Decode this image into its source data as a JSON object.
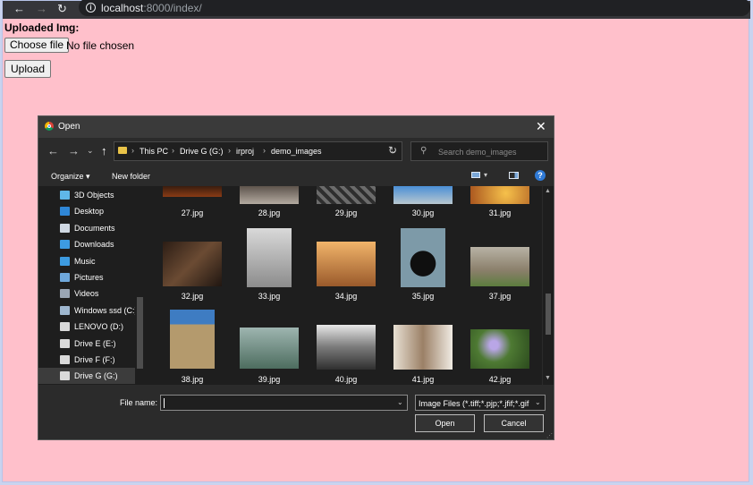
{
  "browser": {
    "url_host": "localhost",
    "url_path": ":8000/index/",
    "back_icon": "←",
    "forward_icon": "→",
    "reload_icon": "↻"
  },
  "page": {
    "label": "Uploaded Img:",
    "choose_button": "Choose file",
    "no_file_text": "No file chosen",
    "upload_button": "Upload"
  },
  "dialog": {
    "title": "Open",
    "close_icon": "✕",
    "breadcrumb": [
      "This PC",
      "Drive G (G:)",
      "irproj",
      "demo_images"
    ],
    "search_placeholder": "Search demo_images",
    "organize_label": "Organize ▾",
    "new_folder_label": "New folder",
    "help_label": "?",
    "sidebar": [
      {
        "label": "3D Objects",
        "icon": "cube-icon",
        "color": "#5fb7e8"
      },
      {
        "label": "Desktop",
        "icon": "desktop-icon",
        "color": "#2f86d6"
      },
      {
        "label": "Documents",
        "icon": "document-icon",
        "color": "#cfd8e3"
      },
      {
        "label": "Downloads",
        "icon": "download-icon",
        "color": "#3d9be0"
      },
      {
        "label": "Music",
        "icon": "music-icon",
        "color": "#3d9be0"
      },
      {
        "label": "Pictures",
        "icon": "pictures-icon",
        "color": "#6fa8dc"
      },
      {
        "label": "Videos",
        "icon": "videos-icon",
        "color": "#9aa6b5"
      },
      {
        "label": "Windows ssd (C:)",
        "icon": "drive-icon",
        "color": "#9fb7cf"
      },
      {
        "label": "LENOVO (D:)",
        "icon": "drive-icon",
        "color": "#d9d9d9"
      },
      {
        "label": "Drive E (E:)",
        "icon": "drive-icon",
        "color": "#d9d9d9"
      },
      {
        "label": "Drive F (F:)",
        "icon": "drive-icon",
        "color": "#d9d9d9"
      },
      {
        "label": "Drive G (G:)",
        "icon": "drive-icon",
        "color": "#d9d9d9",
        "selected": true
      }
    ],
    "files_row1": [
      "27.jpg",
      "28.jpg",
      "29.jpg",
      "30.jpg",
      "31.jpg"
    ],
    "files_row2": [
      "32.jpg",
      "33.jpg",
      "34.jpg",
      "35.jpg",
      "37.jpg"
    ],
    "files_row3": [
      "38.jpg",
      "39.jpg",
      "40.jpg",
      "41.jpg",
      "42.jpg"
    ],
    "file_name_label": "File name:",
    "file_name_value": "",
    "file_type": "Image Files (*.tiff;*.pjp;*.jfif;*.gif",
    "open_button": "Open",
    "cancel_button": "Cancel"
  }
}
